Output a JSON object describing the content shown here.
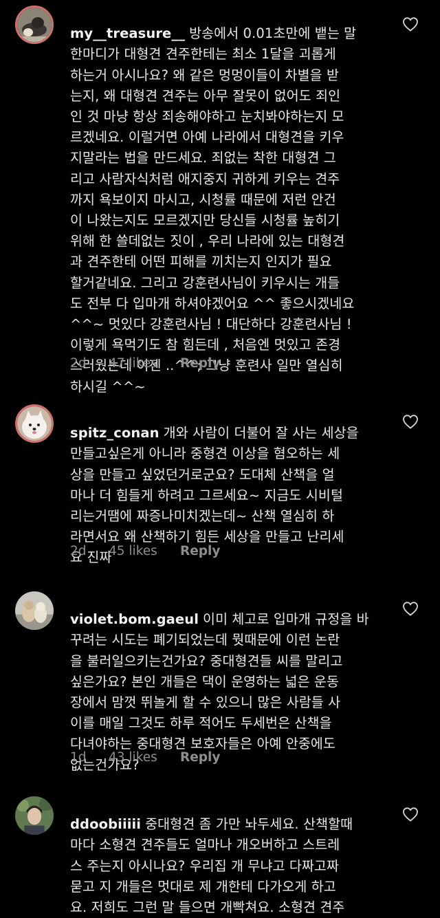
{
  "comments": [
    {
      "username": "my__treasure__",
      "text": "방송에서 0.01초만에 뱉는 말\n한마디가 대형견 견주한테는 최소 1달을 괴롭게\n하는거 아시나요? 왜 같은 멍멍이들이 차별을 받\n는지, 왜 대형견 견주는 아무 잘못이 없어도 죄인\n인 것 마냥 항상 죄송해야하고 눈치봐야하는지 모\n르겠네요. 이럴거면 아예 나라에서 대형견을 키우\n지말라는 법을 만드세요. 죄없는 착한 대형견 그\n리고 사람자식처럼 애지중지 귀하게 키우는 견주\n까지 욕보이지 마시고, 시청률 때문에 저런 안건\n이 나왔는지도 모르겠지만 당신들 시청률 높히기\n위해 한 쓸데없는 짓이 , 우리 나라에 있는 대형견\n과 견주한테 어떤 피해를 끼치는지 인지가 필요\n할거같네요. 그리고 강훈련사님이 키우시는 개들\n도 전부 다 입마개 하셔야겠어요 ^^ 좋으시겠네요\n^^~ 멋있다 강훈련사님 ! 대단하다 강훈련사님 !\n이렇게 욕먹기도 참 힘든데 , 처음엔 멋있고 존경\n스러웠는데 이젠 ..^^; 그냥 훈련사 일만 열심히\n하시길 ^^~",
      "time": "2d",
      "likes": "47 likes",
      "reply": "Reply"
    },
    {
      "username": "spitz_conan",
      "text": "개와 사람이 더불어 잘 사는 세상을\n만들고싶은게 아니라 중형견 이상을 혐오하는 세\n상을 만들고 싶었던거로군요? 도대체 산책을 얼\n마나 더 힘들게 하려고 그르세요~ 지금도 시비털\n리는거땜에 짜증나미치겠는데~ 산책 열심히 하\n라면서요 왜 산책하기 힘든 세상을 만들고 난리세\n요 진짜",
      "time": "2d",
      "likes": "45 likes",
      "reply": "Reply"
    },
    {
      "username": "violet.bom.gaeul",
      "text": "이미 체고로 입마개 규정을 바\n꾸려는 시도는 폐기되었는데 뭣때문에 이런 논란\n을 불러일으키는건가요? 중대형견들 씨를 말리고\n싶은가요? 본인 개들은 댁이 운영하는 넓은 운동\n장에서 맘껏 뛰놀게 할 수 있으니 많은 사람들 사\n이를 매일 그것도 하루 적어도 두세번은 산책을\n다녀야하는 중대형견 보호자들은 아예 안중에도\n없는건가요?",
      "time": "1d",
      "likes": "43 likes",
      "reply": "Reply"
    },
    {
      "username": "ddoobiiiii",
      "text": "중대형견 좀 가만 놔두세요. 산책할때\n마다 소형견 견주들도 얼마나 개오버하고 스트레\n스 주는지 아시나요? 우리집 개 무냐고 다짜고짜\n묻고 지 개들은 멋대로 제 개한테 다가오게 하고\n요. 저희도 그런 말 들으면 개빡쳐요. 소형견 견주"
    }
  ],
  "icons": {
    "like": "heart-outline-icon"
  },
  "colors": {
    "background": "#000000",
    "text": "#e6e6e6",
    "muted": "#8e8e8e",
    "story_ring": "#d0706a"
  }
}
